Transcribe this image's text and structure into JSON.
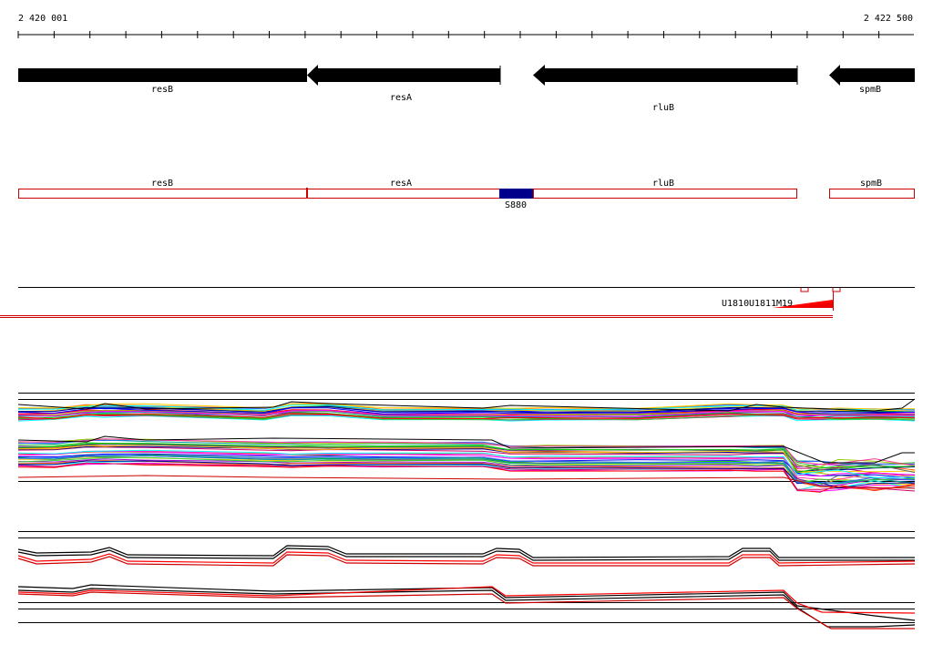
{
  "coordinates": {
    "start_label": "2 420 001",
    "end_label": "2 422 500"
  },
  "gene_track": [
    {
      "label": "resB"
    },
    {
      "label": "resA"
    },
    {
      "label": "rluB"
    },
    {
      "label": "spmB"
    }
  ],
  "transcript_track": {
    "segments": [
      {
        "label": "resB"
      },
      {
        "label": "resA"
      },
      {
        "label": "rluB"
      },
      {
        "label": "spmB"
      }
    ],
    "feature": {
      "label": "S880",
      "color": "#00008b"
    }
  },
  "marker_track": {
    "labels": [
      "U1810",
      "U1811",
      "M19"
    ],
    "color": "#ff0000"
  },
  "colors": {
    "gene_fill": "#000000",
    "transcript_outline": "#cc0000",
    "expression_highlight": "#ff0000",
    "ruler": "#000000"
  }
}
